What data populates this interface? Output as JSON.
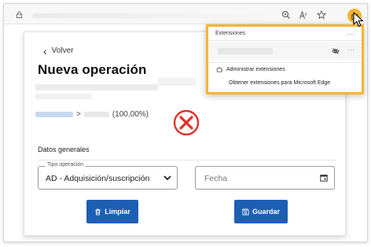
{
  "browser": {
    "extensions_button_icon": "puzzle-icon"
  },
  "page": {
    "back_label": "Volver",
    "title": "Nueva operación",
    "breadcrumb_separator": ">",
    "breadcrumb_percent": "(100,00%)",
    "status_icon": "error-x-icon",
    "section_label": "Datos generales",
    "operation_type": {
      "legend": "Tipo operación",
      "value": "AD - Adquisición/suscripción"
    },
    "date_field": {
      "placeholder": "Fecha"
    },
    "clear_button_label": "Limpiar",
    "save_button_label": "Guardar"
  },
  "extensions_popup": {
    "header": "Extensiones",
    "more_label": "...",
    "manage_label": "Administrar extensiones",
    "get_label": "Obtener extensiones para Microsoft Edge"
  },
  "colors": {
    "primary_button": "#1e5fb4",
    "highlight_border": "#f5b532",
    "error_red": "#e0312b"
  }
}
